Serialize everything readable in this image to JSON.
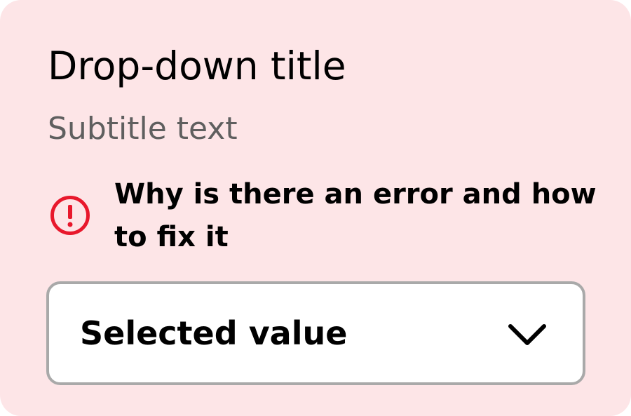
{
  "dropdown": {
    "title": "Drop-down title",
    "subtitle": "Subtitle text",
    "error_message": "Why is there an error and how to fix it",
    "selected_value": "Selected value",
    "error_icon": "exclamation-circle-icon",
    "chevron_icon": "chevron-down-icon"
  },
  "colors": {
    "background": "#fde5e7",
    "error": "#e8182c",
    "title_text": "#000000",
    "subtitle_text": "#5f5f5f",
    "select_border": "#a9a9a9",
    "select_background": "#ffffff"
  }
}
